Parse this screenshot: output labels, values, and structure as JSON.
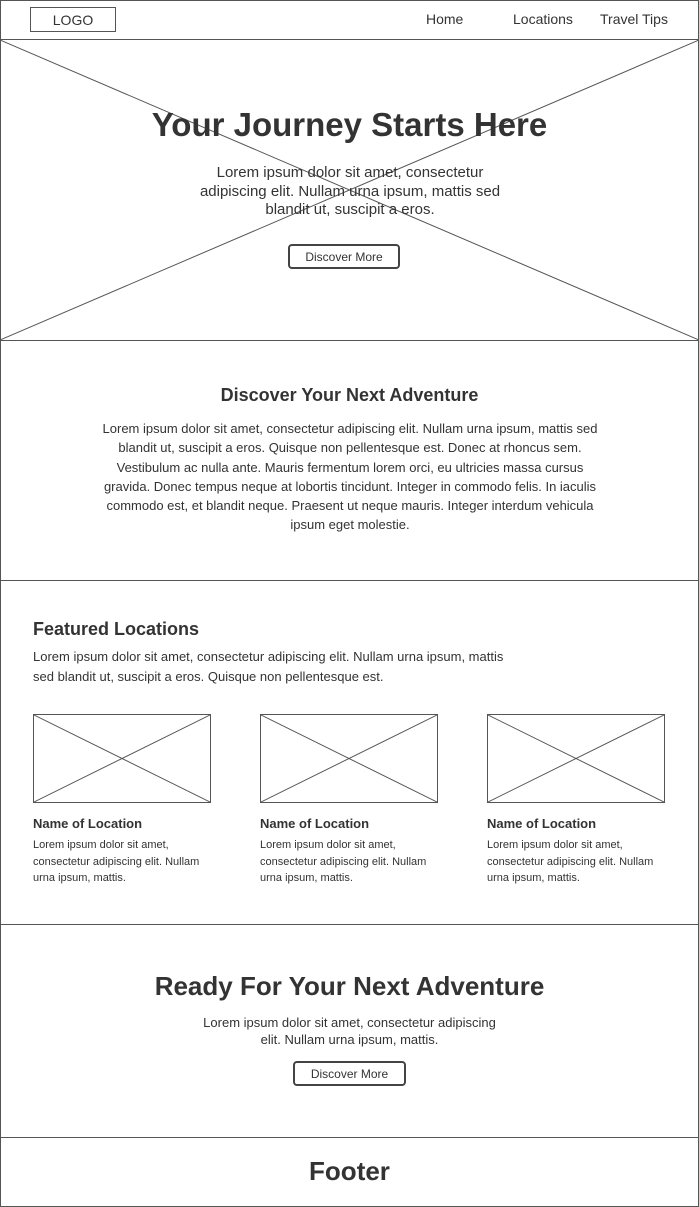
{
  "header": {
    "logo": "LOGO",
    "nav": [
      {
        "label": "Home"
      },
      {
        "label": "Locations"
      },
      {
        "label": "Travel Tips"
      }
    ]
  },
  "hero": {
    "title": "Your Journey Starts Here",
    "text": "Lorem ipsum dolor sit amet, consectetur adipiscing elit. Nullam urna ipsum, mattis sed blandit ut, suscipit a eros.",
    "button_label": "Discover More"
  },
  "intro": {
    "title": "Discover Your Next Adventure",
    "text": "Lorem ipsum dolor sit amet, consectetur adipiscing elit. Nullam urna ipsum, mattis sed blandit ut, suscipit a eros. Quisque non pellentesque est. Donec at rhoncus sem. Vestibulum ac nulla ante. Mauris fermentum lorem orci, eu ultricies massa cursus gravida. Donec tempus neque at lobortis tincidunt. Integer in commodo felis. In iaculis commodo est, et blandit neque. Praesent ut neque mauris. Integer interdum vehicula ipsum eget molestie."
  },
  "featured": {
    "title": "Featured Locations",
    "text": "Lorem ipsum dolor sit amet, consectetur adipiscing elit. Nullam urna ipsum, mattis sed blandit ut, suscipit a eros. Quisque non pellentesque est.",
    "cards": [
      {
        "title": "Name of Location",
        "text": "Lorem ipsum dolor sit amet, consectetur adipiscing elit. Nullam urna ipsum, mattis."
      },
      {
        "title": "Name of Location",
        "text": "Lorem ipsum dolor sit amet, consectetur adipiscing elit. Nullam urna ipsum, mattis."
      },
      {
        "title": "Name of Location",
        "text": "Lorem ipsum dolor sit amet, consectetur adipiscing elit. Nullam urna ipsum, mattis."
      }
    ]
  },
  "cta": {
    "title": "Ready For Your Next Adventure",
    "text": "Lorem ipsum dolor sit amet, consectetur adipiscing elit. Nullam urna ipsum, mattis.",
    "button_label": "Discover More"
  },
  "footer": {
    "title": "Footer"
  },
  "colors": {
    "stroke": "#555555",
    "text": "#333333",
    "background": "#ffffff"
  }
}
